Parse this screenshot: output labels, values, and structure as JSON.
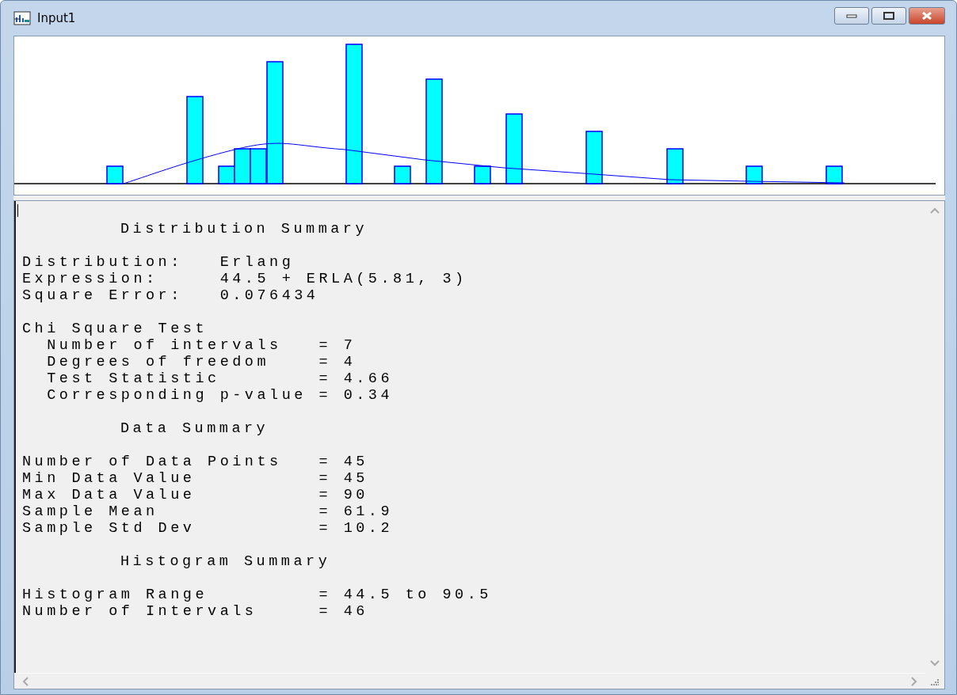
{
  "window": {
    "title": "Input1"
  },
  "report": [
    {
      "kind": "heading",
      "text": "Distribution Summary"
    },
    {
      "kind": "block",
      "lines": [
        "Distribution:   Erlang",
        "Expression:     44.5 + ERLA(5.81, 3)",
        "Square Error:   0.076434"
      ]
    },
    {
      "kind": "block",
      "lines": [
        "Chi Square Test",
        "  Number of intervals   = 7",
        "  Degrees of freedom    = 4",
        "  Test Statistic        = 4.66",
        "  Corresponding p-value = 0.34"
      ]
    },
    {
      "kind": "heading",
      "text": "Data Summary"
    },
    {
      "kind": "block",
      "lines": [
        "Number of Data Points   = 45",
        "Min Data Value          = 45",
        "Max Data Value          = 90",
        "Sample Mean             = 61.9",
        "Sample Std Dev          = 10.2"
      ]
    },
    {
      "kind": "heading",
      "text": "Histogram Summary"
    },
    {
      "kind": "block",
      "lines": [
        "Histogram Range         = 44.5 to 90.5",
        "Number of Intervals     = 46"
      ]
    }
  ]
}
